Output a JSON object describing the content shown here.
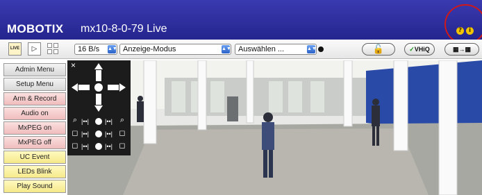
{
  "header": {
    "brand": "MOBOTIX",
    "camera_title": "mx10-8-0-79 Live",
    "help_icons": [
      "?",
      "i"
    ]
  },
  "toolbar": {
    "live_label": "LIVE",
    "frame_rate": "16 B/s",
    "mode_select": "Anzeige-Modus",
    "choose_select": "Auswählen ...",
    "vhiq_label": "VHiQ"
  },
  "sidebar": {
    "items": [
      {
        "label": "Admin Menu"
      },
      {
        "label": "Setup Menu"
      },
      {
        "label": "Arm & Record"
      },
      {
        "label": "Audio on"
      },
      {
        "label": "MxPEG on"
      },
      {
        "label": "MxPEG off"
      },
      {
        "label": "UC Event"
      },
      {
        "label": "LEDs Blink"
      },
      {
        "label": "Play Sound"
      }
    ]
  },
  "ptz": {
    "close_label": "×"
  },
  "colors": {
    "titlebar": "#2b2b9c",
    "highlight_circle": "#d01818",
    "button_grey": "#dcdcdc",
    "button_pink": "#f0bcbc",
    "button_yellow": "#f6e98a"
  },
  "icons": [
    "live-icon",
    "play-icon",
    "grid-icon",
    "lock-icon",
    "help-icon",
    "info-icon",
    "zoom-icon",
    "pan-icon",
    "tilt-icon"
  ]
}
